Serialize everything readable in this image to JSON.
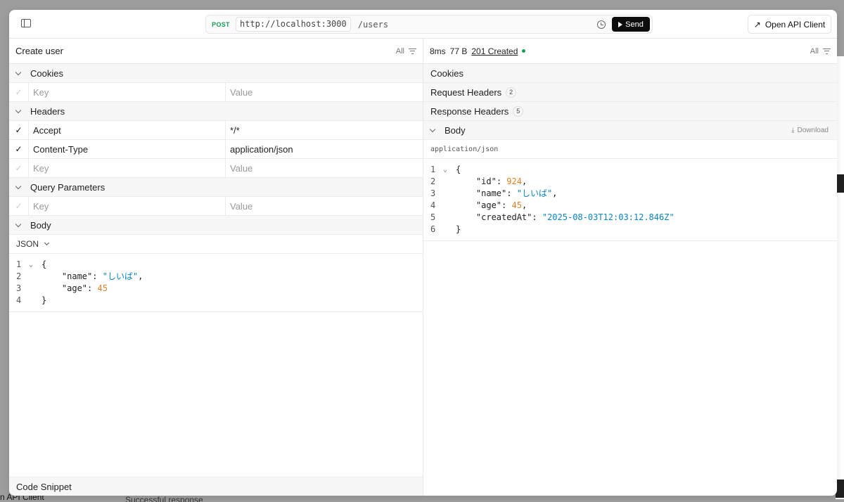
{
  "request": {
    "method": "POST",
    "host": "http://localhost:3000",
    "path": "/users",
    "send_label": "Send"
  },
  "topbar": {
    "open_api_label": "Open API Client"
  },
  "left": {
    "title": "Create user",
    "filter_label": "All",
    "cookies": {
      "label": "Cookies",
      "rows": [
        {
          "key_placeholder": "Key",
          "value_placeholder": "Value"
        }
      ]
    },
    "headers": {
      "label": "Headers",
      "rows": [
        {
          "key": "Accept",
          "value": "*/*"
        },
        {
          "key": "Content-Type",
          "value": "application/json"
        }
      ],
      "empty": {
        "key_placeholder": "Key",
        "value_placeholder": "Value"
      }
    },
    "query": {
      "label": "Query Parameters",
      "rows": [
        {
          "key_placeholder": "Key",
          "value_placeholder": "Value"
        }
      ]
    },
    "body": {
      "label": "Body",
      "format": "JSON",
      "lines": [
        {
          "n": "1",
          "t": "{"
        },
        {
          "n": "2",
          "k": "\"name\"",
          "v": "\"しいば\"",
          "vt": "str"
        },
        {
          "n": "3",
          "k": "\"age\"",
          "v": "45",
          "vt": "num"
        },
        {
          "n": "4",
          "t": "}"
        }
      ]
    },
    "code_snippet": {
      "label": "Code Snippet"
    }
  },
  "response": {
    "time": "8ms",
    "size": "77 B",
    "status": "201 Created",
    "filter_label": "All",
    "cookies_label": "Cookies",
    "request_headers": {
      "label": "Request Headers",
      "count": "2"
    },
    "response_headers": {
      "label": "Response Headers",
      "count": "5"
    },
    "body": {
      "label": "Body",
      "download_label": "Download",
      "mime": "application/json",
      "lines": [
        {
          "n": "1",
          "t": "{"
        },
        {
          "n": "2",
          "k": "\"id\"",
          "v": "924",
          "vt": "num"
        },
        {
          "n": "3",
          "k": "\"name\"",
          "v": "\"しいば\"",
          "vt": "str"
        },
        {
          "n": "4",
          "k": "\"age\"",
          "v": "45",
          "vt": "num"
        },
        {
          "n": "5",
          "k": "\"createdAt\"",
          "v": "\"2025-08-03T12:03:12.846Z\"",
          "vt": "str",
          "last": true
        },
        {
          "n": "6",
          "t": "}"
        }
      ]
    }
  },
  "background": {
    "bottom_left": "n API Client",
    "bottom_mid": "Successful response"
  },
  "colors": {
    "method_post": "#1a9b57",
    "string": "#0a84c1",
    "number": "#e0822b",
    "status_dot": "#1a9b57"
  }
}
